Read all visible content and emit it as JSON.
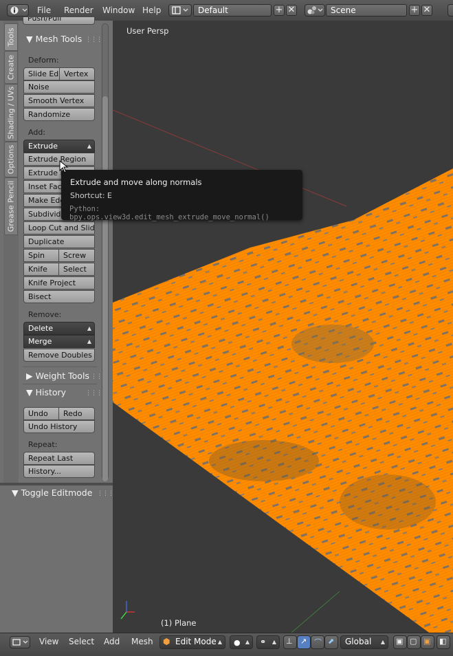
{
  "topbar": {
    "menus": [
      "File",
      "Render",
      "Window",
      "Help"
    ],
    "screen_layout": "Default",
    "scene": "Scene"
  },
  "tabs": [
    "Tools",
    "Create",
    "Shading / UVs",
    "Options",
    "Grease Pencil"
  ],
  "tools_panel": {
    "cut_off_label": "Push/Pull",
    "mesh_tools_title": "Mesh Tools",
    "deform_label": "Deform:",
    "deform": {
      "slide_edge": "Slide Ed",
      "vertex": "Vertex",
      "noise": "Noise",
      "smooth_vertex": "Smooth Vertex",
      "randomize": "Randomize"
    },
    "add_label": "Add:",
    "add": {
      "extrude": "Extrude",
      "extrude_region": "Extrude Region",
      "extrude_individual": "Extrude In",
      "inset_faces": "Inset Face",
      "make_edge": "Make Edge",
      "subdivide": "Subdivide",
      "loop_cut": "Loop Cut and Slide",
      "duplicate": "Duplicate",
      "spin": "Spin",
      "screw": "Screw",
      "knife": "Knife",
      "select": "Select",
      "knife_project": "Knife Project",
      "bisect": "Bisect"
    },
    "remove_label": "Remove:",
    "remove": {
      "delete": "Delete",
      "merge": "Merge",
      "remove_doubles": "Remove Doubles"
    },
    "weight_tools_title": "Weight Tools",
    "history_title": "History",
    "history": {
      "undo": "Undo",
      "redo": "Redo",
      "undo_history": "Undo History"
    },
    "repeat_label": "Repeat:",
    "repeat": {
      "repeat_last": "Repeat Last",
      "history": "History..."
    }
  },
  "operator_panel": {
    "title": "Toggle Editmode"
  },
  "viewport": {
    "view_label": "User Persp",
    "object_label": "(1) Plane"
  },
  "tooltip": {
    "title": "Extrude and move along normals",
    "shortcut": "Shortcut: E",
    "python": "Python: bpy.ops.view3d.edit_mesh_extrude_move_normal()"
  },
  "bottombar": {
    "menus": [
      "View",
      "Select",
      "Add",
      "Mesh"
    ],
    "mode": "Edit Mode",
    "orientation": "Global"
  },
  "colors": {
    "mesh": "#ff8c00",
    "wire": "#e07a00",
    "tooltip_bg": "#191919"
  }
}
